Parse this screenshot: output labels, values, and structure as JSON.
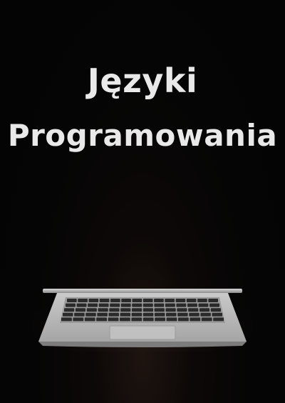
{
  "cover": {
    "title_line1": "Języki",
    "title_line2": "Programowania"
  },
  "illustration": {
    "icon": "laptop-icon",
    "colors": {
      "background": "#050505",
      "title_text": "#e9e9e9",
      "laptop_body": "#b8b8b8",
      "keyboard_keys": "#2a2a2a"
    }
  }
}
